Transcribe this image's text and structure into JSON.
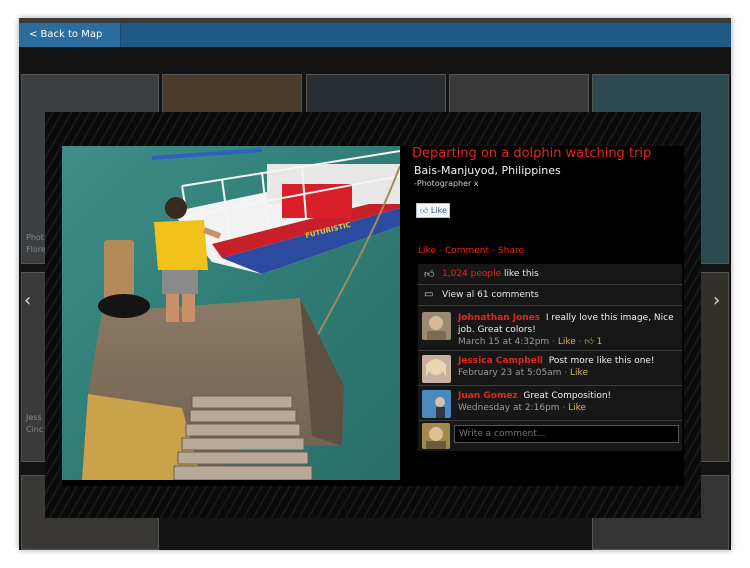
{
  "topbar": {
    "back_label": "< Back to Map"
  },
  "background": {
    "captions": [
      {
        "line1": "Phot",
        "line2": "Flore"
      },
      {
        "line1": "Jess",
        "line2": "Cinc"
      }
    ]
  },
  "nav": {
    "prev_icon": "chevron-left-icon",
    "next_icon": "chevron-right-icon"
  },
  "photo": {
    "title": "Departing on a dolphin watching trip",
    "location": "Bais-Manjuyod, Philippines",
    "photographer": "-Photographer x",
    "boat_text": "FUTURISTIC"
  },
  "like_button": {
    "label": "Like"
  },
  "actions": {
    "like": "Like",
    "comment": "Comment",
    "share": "Share",
    "sep": " - "
  },
  "likes": {
    "count_text": "1,024 people",
    "suffix": " like this"
  },
  "comments_link": {
    "text": "View al 61 comments"
  },
  "comments": [
    {
      "name": "Johnathan Jones",
      "text": "I really love this image, Nice job. Great colors!",
      "date": "March 15 at 4:32pm",
      "like": "Like",
      "likes_count": "1"
    },
    {
      "name": "Jessica Campbell",
      "text": "Post more like this one!",
      "date": "February 23 at 5:05am",
      "like": "Like"
    },
    {
      "name": "Juan Gomez",
      "text": "Great Composition!",
      "date": "Wednesday at 2:16pm",
      "like": "Like"
    }
  ],
  "write": {
    "placeholder": "Write a comment..."
  },
  "colors": {
    "accent": "#e3281b",
    "topbar": "#1f5a86",
    "link": "#d6b25a"
  }
}
